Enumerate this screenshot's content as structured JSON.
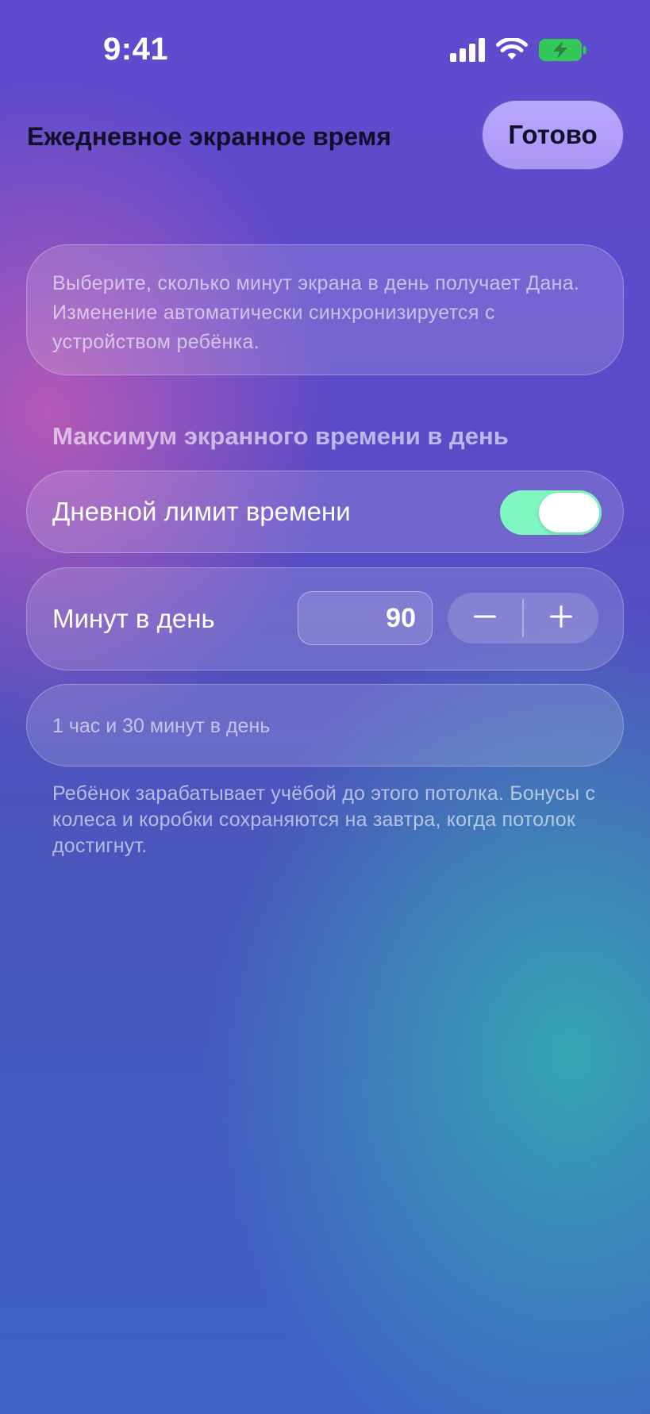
{
  "status_bar": {
    "time": "9:41",
    "icons": [
      "cellular-signal-icon",
      "wifi-icon",
      "battery-charging-icon"
    ],
    "battery_color": "#34c759"
  },
  "header": {
    "title": "Ежедневное экранное время",
    "done_label": "Готово"
  },
  "info": {
    "text": "Выберите, сколько минут экрана в день получает Дана. Изменение автоматически синхронизируется с устройством ребёнка."
  },
  "section": {
    "title": "Максимум экранного времени в день"
  },
  "daily_limit": {
    "label": "Дневной лимит времени",
    "enabled": true,
    "toggle_color": "#7ef7c0"
  },
  "minutes": {
    "label": "Минут в день",
    "value": "90",
    "decrement_icon": "minus-icon",
    "increment_icon": "plus-icon"
  },
  "summary": {
    "text": "1 час и 30 минут в день"
  },
  "footnote": {
    "text": "Ребёнок зарабатывает учёбой до этого потолка. Бонусы с колеса и коробки сохраняются на завтра, когда потолок достигнут."
  }
}
